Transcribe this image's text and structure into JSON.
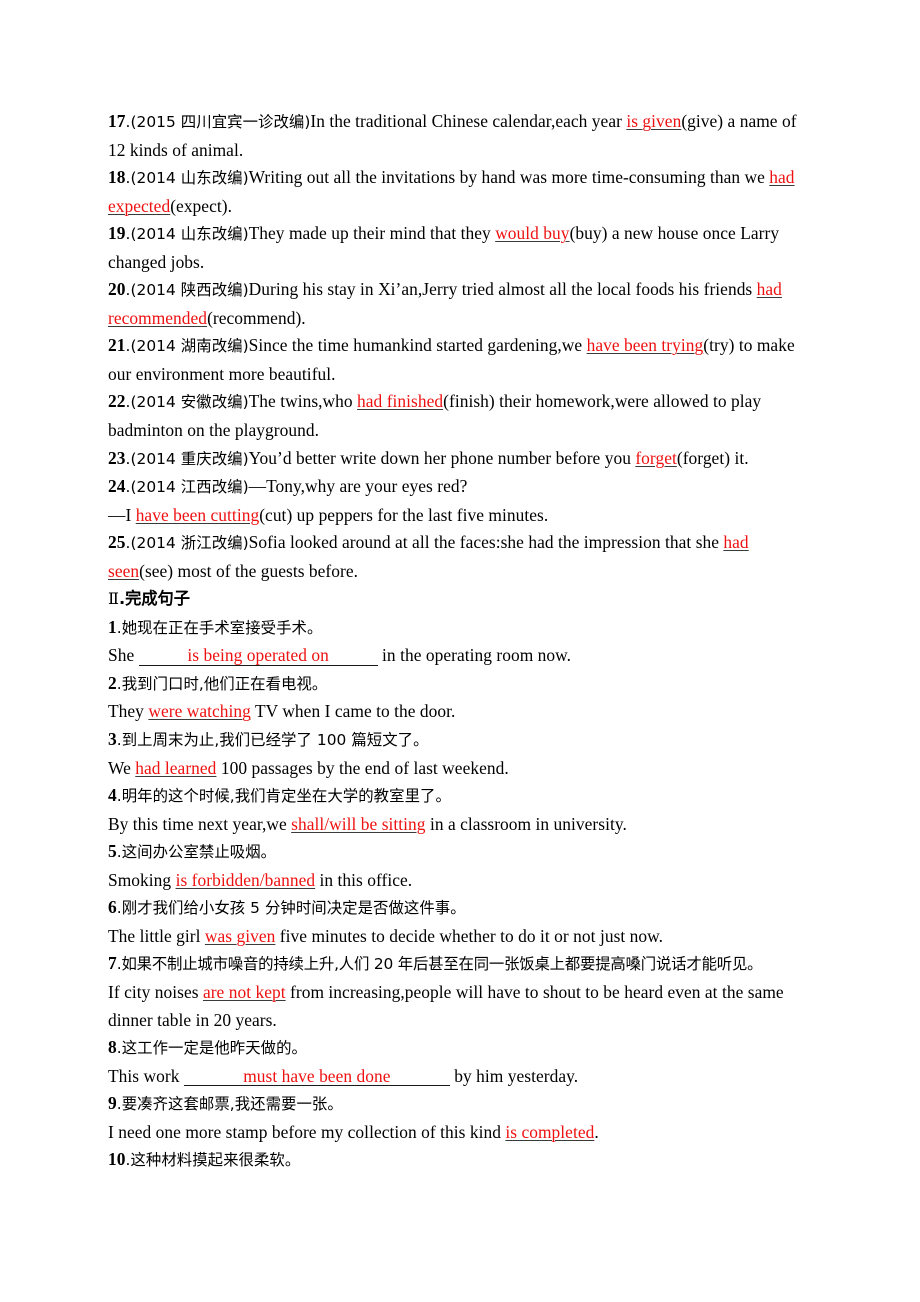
{
  "document": {
    "type": "grammar-exercise-answer-key",
    "answer_color": "#ee1111",
    "text_color": "#000000",
    "background_color": "#ffffff"
  },
  "section_1": {
    "items": [
      {
        "number": "17",
        "source": ".(2015 四川宜宾一诊改编)",
        "before": "In the traditional Chinese calendar,each year ",
        "answer": "is given",
        "after": "(give) a name of 12 kinds of animal."
      },
      {
        "number": "18",
        "source": ".(2014 山东改编)",
        "before": "Writing out all the invitations by hand was more time-consuming than we ",
        "answer": "had expected",
        "after": "(expect)."
      },
      {
        "number": "19",
        "source": ".(2014 山东改编)",
        "before": "They made up their mind that they ",
        "answer": "would buy",
        "after": "(buy) a new house once Larry changed jobs."
      },
      {
        "number": "20",
        "source": ".(2014 陕西改编)",
        "before": "During his stay in Xi’an,Jerry tried almost all the local foods his friends ",
        "answer": "had recommended",
        "after": "(recommend)."
      },
      {
        "number": "21",
        "source": ".(2014 湖南改编)",
        "before": "Since the time humankind started gardening,we ",
        "answer": "have been trying",
        "after": "(try) to make our environment more beautiful."
      },
      {
        "number": "22",
        "source": ".(2014 安徽改编)",
        "before": "The twins,who ",
        "answer": "had finished",
        "after": "(finish) their homework,were allowed to play badminton on the playground."
      },
      {
        "number": "23",
        "source": ".(2014 重庆改编)",
        "before": "You’d better write down her phone number before you ",
        "answer": "forget",
        "after": "(forget) it."
      },
      {
        "number": "24",
        "source": ".(2014 江西改编)",
        "before": "—Tony,why are your eyes red?",
        "answer": "",
        "after": ""
      },
      {
        "number": "",
        "source": "",
        "before": "—I ",
        "answer": "have been cutting",
        "after": "(cut) up peppers for the last five minutes."
      },
      {
        "number": "25",
        "source": ".(2014 浙江改编)",
        "before": "Sofia looked around at all the faces:she had the impression that she ",
        "answer": "had seen",
        "after": "(see) most of the guests before."
      }
    ]
  },
  "section_2": {
    "heading_numeral": "Ⅱ",
    "heading_text": ".完成句子",
    "items": [
      {
        "number": "1",
        "chinese": ".她现在正在手术室接受手术。",
        "english_before": "She ",
        "blank_answer": "is being operated on",
        "blank_style": "long-underline",
        "english_after": " in the operating room now."
      },
      {
        "number": "2",
        "chinese": ".我到门口时,他们正在看电视。",
        "english_before": "They ",
        "blank_answer": "were watching",
        "blank_style": "inline",
        "english_after": " TV when I came to the door."
      },
      {
        "number": "3",
        "chinese": ".到上周末为止,我们已经学了 100 篇短文了。",
        "english_before": "We ",
        "blank_answer": "had learned",
        "blank_style": "inline",
        "english_after": " 100 passages by the end of last weekend."
      },
      {
        "number": "4",
        "chinese": ".明年的这个时候,我们肯定坐在大学的教室里了。",
        "english_before": "By this time next year,we ",
        "blank_answer": "shall/will be sitting",
        "blank_style": "inline",
        "english_after": " in a classroom in university."
      },
      {
        "number": "5",
        "chinese": ".这间办公室禁止吸烟。",
        "english_before": "Smoking ",
        "blank_answer": "is forbidden/banned",
        "blank_style": "inline",
        "english_after": " in this office."
      },
      {
        "number": "6",
        "chinese": ".刚才我们给小女孩 5 分钟时间决定是否做这件事。",
        "english_before": "The little girl ",
        "blank_answer": "was given",
        "blank_style": "inline",
        "english_after": " five minutes to decide whether to do it or not just now."
      },
      {
        "number": "7",
        "chinese": ".如果不制止城市噪音的持续上升,人们 20 年后甚至在同一张饭桌上都要提高嗓门说话才能听见。",
        "english_before": "If city noises ",
        "blank_answer": "are not kept",
        "blank_style": "inline",
        "english_after": " from increasing,people will have to shout to be heard even at the same dinner table in 20 years."
      },
      {
        "number": "8",
        "chinese": ".这工作一定是他昨天做的。",
        "english_before": "This work ",
        "blank_answer": "must have been done",
        "blank_style": "long-underline",
        "english_after": " by him yesterday."
      },
      {
        "number": "9",
        "chinese": ".要凑齐这套邮票,我还需要一张。",
        "english_before": "I need one more stamp before my collection of this kind ",
        "blank_answer": "is completed",
        "blank_style": "inline",
        "english_after": "."
      },
      {
        "number": "10",
        "chinese": ".这种材料摸起来很柔软。",
        "english_before": "",
        "blank_answer": "",
        "blank_style": "none",
        "english_after": ""
      }
    ]
  }
}
